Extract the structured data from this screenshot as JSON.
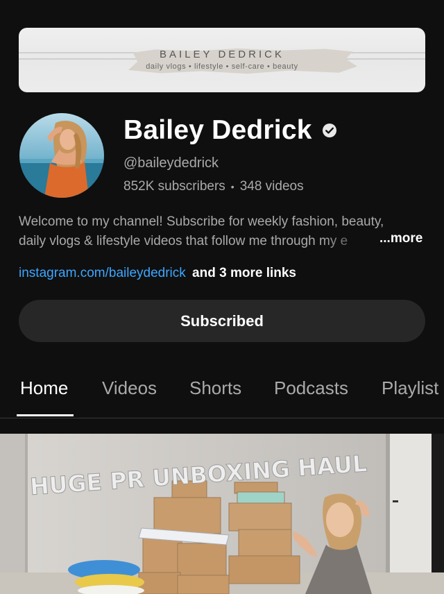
{
  "banner": {
    "title": "BAILEY DEDRICK",
    "subtitle": "daily vlogs  •  lifestyle  •  self-care  •  beauty"
  },
  "channel": {
    "name": "Bailey Dedrick",
    "handle": "@baileydedrick",
    "subscribers": "852K subscribers",
    "separator": "•",
    "videos": "348 videos",
    "verified_icon": "verified-check-icon"
  },
  "description": {
    "line1": "Welcome to my channel! Subscribe for weekly fashion, beauty,",
    "line2": "daily vlogs & lifestyle videos that follow me through my e",
    "more": "...more"
  },
  "links": {
    "primary": "instagram.com/baileydedrick",
    "more": "and 3 more links"
  },
  "subscribe_button": {
    "label": "Subscribed"
  },
  "tabs": [
    {
      "label": "Home",
      "active": true
    },
    {
      "label": "Videos",
      "active": false
    },
    {
      "label": "Shorts",
      "active": false
    },
    {
      "label": "Podcasts",
      "active": false
    },
    {
      "label": "Playlist",
      "active": false
    }
  ],
  "featured_video": {
    "thumbnail_text": "HUGE PR UNBOXING HAUL"
  },
  "colors": {
    "background": "#0f0f0f",
    "link": "#3ea6ff",
    "button": "#272727",
    "secondary_text": "#aaaaaa"
  }
}
